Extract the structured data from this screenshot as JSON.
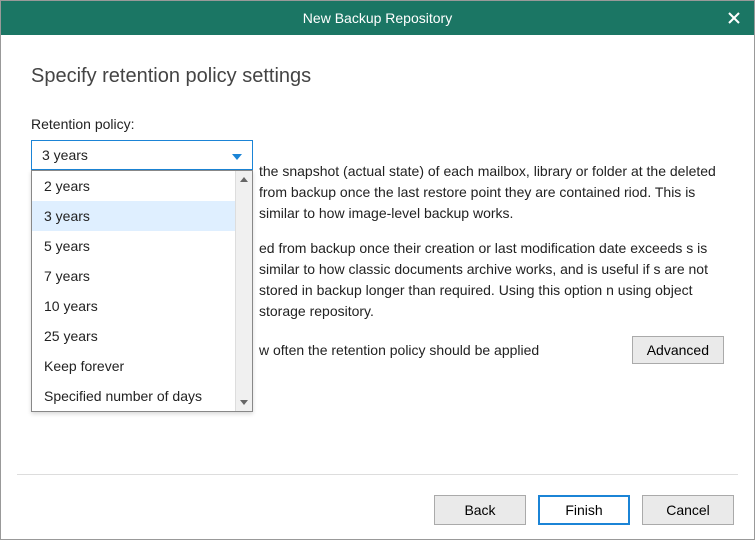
{
  "window": {
    "title": "New Backup Repository"
  },
  "page": {
    "heading": "Specify retention policy settings",
    "retention_label": "Retention policy:",
    "selected_value": "3 years",
    "dropdown_options": [
      "2 years",
      "3 years",
      "5 years",
      "7 years",
      "10 years",
      "25 years",
      "Keep forever",
      "Specified number of days"
    ],
    "highlighted_index": 1
  },
  "body": {
    "para1": "the snapshot (actual state) of each mailbox, library or folder at the deleted from backup once the last restore point they are contained riod. This is similar to how image-level backup works.",
    "para2": "ed from backup once their creation or last modification date exceeds s is similar to how classic documents archive works, and is useful if s are not stored in backup longer than required. Using this option n using object storage repository.",
    "adv_text": "w often the retention policy should be applied",
    "adv_button": "Advanced"
  },
  "footer": {
    "back": "Back",
    "finish": "Finish",
    "cancel": "Cancel"
  }
}
